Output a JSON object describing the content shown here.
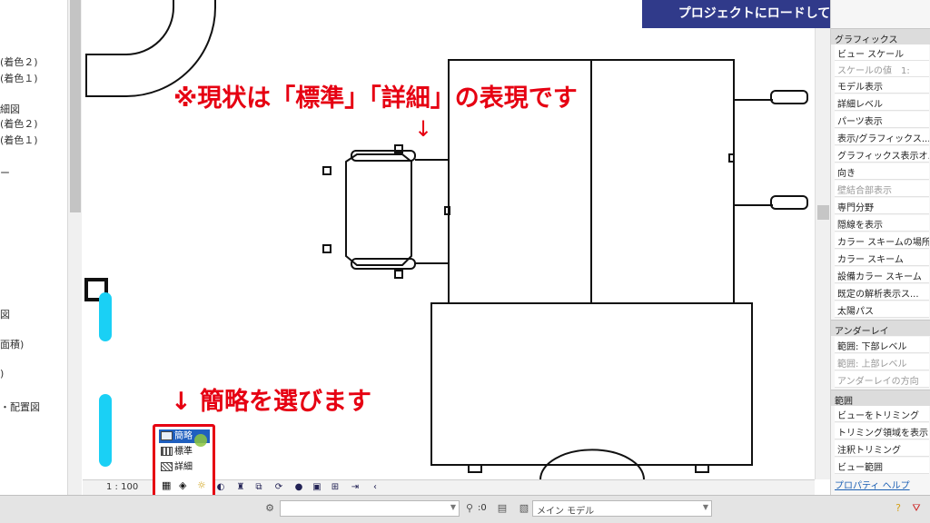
{
  "banner": {
    "title": "プロジェクトにロードして確認します"
  },
  "project_browser": {
    "items": [
      {
        "label": "(着色２)"
      },
      {
        "label": "(着色１)"
      },
      {
        "label": ""
      },
      {
        "label": "細図"
      },
      {
        "label": "(着色２)"
      },
      {
        "label": "(着色１)"
      },
      {
        "label": "ー"
      },
      {
        "label": "図"
      },
      {
        "label": "面積)"
      },
      {
        "label": ")"
      },
      {
        "label": "・配置図"
      }
    ]
  },
  "annotations": {
    "main_note": "※現状は「標準」「詳細」の表現です",
    "arrow": "↓",
    "select_note": "↓ 簡略を選びます"
  },
  "properties": {
    "sections": [
      {
        "title": "グラフィックス",
        "rows": [
          {
            "label": "ビュー スケール",
            "disabled": false
          },
          {
            "label": "スケールの値　1:",
            "disabled": true
          },
          {
            "label": "モデル表示",
            "disabled": false
          },
          {
            "label": "詳細レベル",
            "disabled": false
          },
          {
            "label": "パーツ表示",
            "disabled": false
          },
          {
            "label": "表示/グラフィックス...",
            "disabled": false
          },
          {
            "label": "グラフィックス表示オ...",
            "disabled": false
          },
          {
            "label": "向き",
            "disabled": false
          },
          {
            "label": "壁結合部表示",
            "disabled": true
          },
          {
            "label": "専門分野",
            "disabled": false
          },
          {
            "label": "隠線を表示",
            "disabled": false
          },
          {
            "label": "カラー スキームの場所",
            "disabled": false
          },
          {
            "label": "カラー スキーム",
            "disabled": false
          },
          {
            "label": "設備カラー スキーム",
            "disabled": false
          },
          {
            "label": "既定の解析表示ス...",
            "disabled": false
          },
          {
            "label": "太陽パス",
            "disabled": false
          }
        ]
      },
      {
        "title": "アンダーレイ",
        "rows": [
          {
            "label": "範囲: 下部レベル",
            "disabled": false
          },
          {
            "label": "範囲: 上部レベル",
            "disabled": true
          },
          {
            "label": "アンダーレイの方向",
            "disabled": true
          }
        ]
      },
      {
        "title": "範囲",
        "rows": [
          {
            "label": "ビューをトリミング",
            "disabled": false
          },
          {
            "label": "トリミング領域を表示",
            "disabled": false
          },
          {
            "label": "注釈トリミング",
            "disabled": false
          },
          {
            "label": "ビュー範囲",
            "disabled": false
          }
        ]
      }
    ],
    "help_link": "プロパティ ヘルプ"
  },
  "view_bar": {
    "scale": "1 : 100"
  },
  "detail_level_menu": {
    "options": [
      {
        "label": "簡略",
        "selected": true
      },
      {
        "label": "標準",
        "selected": false
      },
      {
        "label": "詳細",
        "selected": false
      }
    ]
  },
  "status_bar": {
    "count": ":0",
    "model_select": "メイン モデル"
  },
  "colors": {
    "accent_red": "#e60012",
    "banner_bg": "#303a8a",
    "highlight_blue": "#1f5fbf",
    "cyan_marker": "#1ad0f5"
  }
}
